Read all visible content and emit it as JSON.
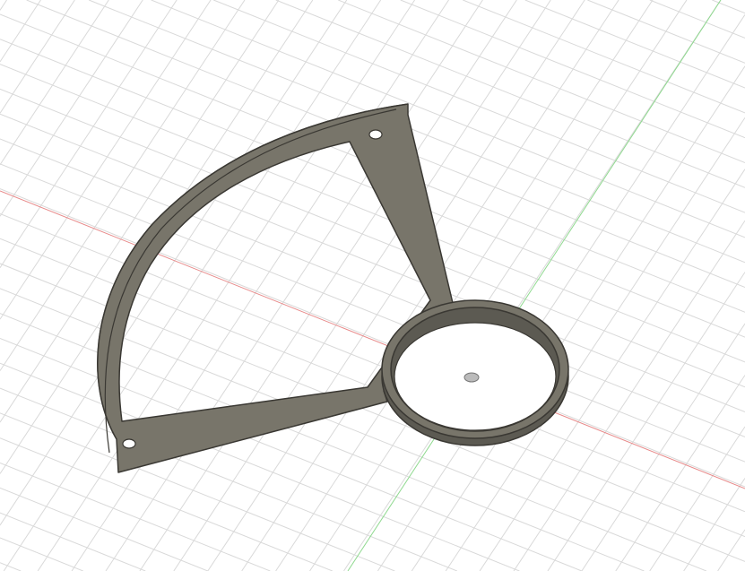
{
  "viewport": {
    "background": "#ffffff",
    "grid_color": "#d9d9d9",
    "x_axis_color": "#e88a8a",
    "y_axis_color": "#8fd98f"
  },
  "model": {
    "body_color": "#78756a",
    "edge_color": "#3a3833",
    "face_light": "#8a877c",
    "face_dark": "#5c5a52"
  }
}
